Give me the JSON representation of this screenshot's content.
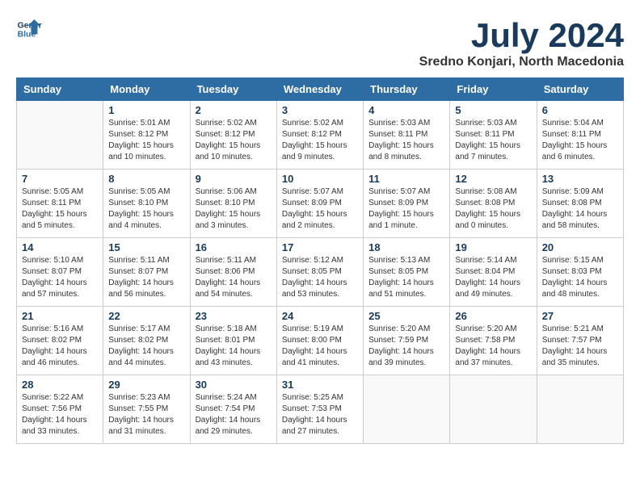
{
  "header": {
    "logo_line1": "General",
    "logo_line2": "Blue",
    "title": "July 2024",
    "subtitle": "Sredno Konjari, North Macedonia"
  },
  "days_of_week": [
    "Sunday",
    "Monday",
    "Tuesday",
    "Wednesday",
    "Thursday",
    "Friday",
    "Saturday"
  ],
  "weeks": [
    [
      {
        "day": "",
        "sunrise": "",
        "sunset": "",
        "daylight": ""
      },
      {
        "day": "1",
        "sunrise": "Sunrise: 5:01 AM",
        "sunset": "Sunset: 8:12 PM",
        "daylight": "Daylight: 15 hours and 10 minutes."
      },
      {
        "day": "2",
        "sunrise": "Sunrise: 5:02 AM",
        "sunset": "Sunset: 8:12 PM",
        "daylight": "Daylight: 15 hours and 10 minutes."
      },
      {
        "day": "3",
        "sunrise": "Sunrise: 5:02 AM",
        "sunset": "Sunset: 8:12 PM",
        "daylight": "Daylight: 15 hours and 9 minutes."
      },
      {
        "day": "4",
        "sunrise": "Sunrise: 5:03 AM",
        "sunset": "Sunset: 8:11 PM",
        "daylight": "Daylight: 15 hours and 8 minutes."
      },
      {
        "day": "5",
        "sunrise": "Sunrise: 5:03 AM",
        "sunset": "Sunset: 8:11 PM",
        "daylight": "Daylight: 15 hours and 7 minutes."
      },
      {
        "day": "6",
        "sunrise": "Sunrise: 5:04 AM",
        "sunset": "Sunset: 8:11 PM",
        "daylight": "Daylight: 15 hours and 6 minutes."
      }
    ],
    [
      {
        "day": "7",
        "sunrise": "Sunrise: 5:05 AM",
        "sunset": "Sunset: 8:11 PM",
        "daylight": "Daylight: 15 hours and 5 minutes."
      },
      {
        "day": "8",
        "sunrise": "Sunrise: 5:05 AM",
        "sunset": "Sunset: 8:10 PM",
        "daylight": "Daylight: 15 hours and 4 minutes."
      },
      {
        "day": "9",
        "sunrise": "Sunrise: 5:06 AM",
        "sunset": "Sunset: 8:10 PM",
        "daylight": "Daylight: 15 hours and 3 minutes."
      },
      {
        "day": "10",
        "sunrise": "Sunrise: 5:07 AM",
        "sunset": "Sunset: 8:09 PM",
        "daylight": "Daylight: 15 hours and 2 minutes."
      },
      {
        "day": "11",
        "sunrise": "Sunrise: 5:07 AM",
        "sunset": "Sunset: 8:09 PM",
        "daylight": "Daylight: 15 hours and 1 minute."
      },
      {
        "day": "12",
        "sunrise": "Sunrise: 5:08 AM",
        "sunset": "Sunset: 8:08 PM",
        "daylight": "Daylight: 15 hours and 0 minutes."
      },
      {
        "day": "13",
        "sunrise": "Sunrise: 5:09 AM",
        "sunset": "Sunset: 8:08 PM",
        "daylight": "Daylight: 14 hours and 58 minutes."
      }
    ],
    [
      {
        "day": "14",
        "sunrise": "Sunrise: 5:10 AM",
        "sunset": "Sunset: 8:07 PM",
        "daylight": "Daylight: 14 hours and 57 minutes."
      },
      {
        "day": "15",
        "sunrise": "Sunrise: 5:11 AM",
        "sunset": "Sunset: 8:07 PM",
        "daylight": "Daylight: 14 hours and 56 minutes."
      },
      {
        "day": "16",
        "sunrise": "Sunrise: 5:11 AM",
        "sunset": "Sunset: 8:06 PM",
        "daylight": "Daylight: 14 hours and 54 minutes."
      },
      {
        "day": "17",
        "sunrise": "Sunrise: 5:12 AM",
        "sunset": "Sunset: 8:05 PM",
        "daylight": "Daylight: 14 hours and 53 minutes."
      },
      {
        "day": "18",
        "sunrise": "Sunrise: 5:13 AM",
        "sunset": "Sunset: 8:05 PM",
        "daylight": "Daylight: 14 hours and 51 minutes."
      },
      {
        "day": "19",
        "sunrise": "Sunrise: 5:14 AM",
        "sunset": "Sunset: 8:04 PM",
        "daylight": "Daylight: 14 hours and 49 minutes."
      },
      {
        "day": "20",
        "sunrise": "Sunrise: 5:15 AM",
        "sunset": "Sunset: 8:03 PM",
        "daylight": "Daylight: 14 hours and 48 minutes."
      }
    ],
    [
      {
        "day": "21",
        "sunrise": "Sunrise: 5:16 AM",
        "sunset": "Sunset: 8:02 PM",
        "daylight": "Daylight: 14 hours and 46 minutes."
      },
      {
        "day": "22",
        "sunrise": "Sunrise: 5:17 AM",
        "sunset": "Sunset: 8:02 PM",
        "daylight": "Daylight: 14 hours and 44 minutes."
      },
      {
        "day": "23",
        "sunrise": "Sunrise: 5:18 AM",
        "sunset": "Sunset: 8:01 PM",
        "daylight": "Daylight: 14 hours and 43 minutes."
      },
      {
        "day": "24",
        "sunrise": "Sunrise: 5:19 AM",
        "sunset": "Sunset: 8:00 PM",
        "daylight": "Daylight: 14 hours and 41 minutes."
      },
      {
        "day": "25",
        "sunrise": "Sunrise: 5:20 AM",
        "sunset": "Sunset: 7:59 PM",
        "daylight": "Daylight: 14 hours and 39 minutes."
      },
      {
        "day": "26",
        "sunrise": "Sunrise: 5:20 AM",
        "sunset": "Sunset: 7:58 PM",
        "daylight": "Daylight: 14 hours and 37 minutes."
      },
      {
        "day": "27",
        "sunrise": "Sunrise: 5:21 AM",
        "sunset": "Sunset: 7:57 PM",
        "daylight": "Daylight: 14 hours and 35 minutes."
      }
    ],
    [
      {
        "day": "28",
        "sunrise": "Sunrise: 5:22 AM",
        "sunset": "Sunset: 7:56 PM",
        "daylight": "Daylight: 14 hours and 33 minutes."
      },
      {
        "day": "29",
        "sunrise": "Sunrise: 5:23 AM",
        "sunset": "Sunset: 7:55 PM",
        "daylight": "Daylight: 14 hours and 31 minutes."
      },
      {
        "day": "30",
        "sunrise": "Sunrise: 5:24 AM",
        "sunset": "Sunset: 7:54 PM",
        "daylight": "Daylight: 14 hours and 29 minutes."
      },
      {
        "day": "31",
        "sunrise": "Sunrise: 5:25 AM",
        "sunset": "Sunset: 7:53 PM",
        "daylight": "Daylight: 14 hours and 27 minutes."
      },
      {
        "day": "",
        "sunrise": "",
        "sunset": "",
        "daylight": ""
      },
      {
        "day": "",
        "sunrise": "",
        "sunset": "",
        "daylight": ""
      },
      {
        "day": "",
        "sunrise": "",
        "sunset": "",
        "daylight": ""
      }
    ]
  ]
}
